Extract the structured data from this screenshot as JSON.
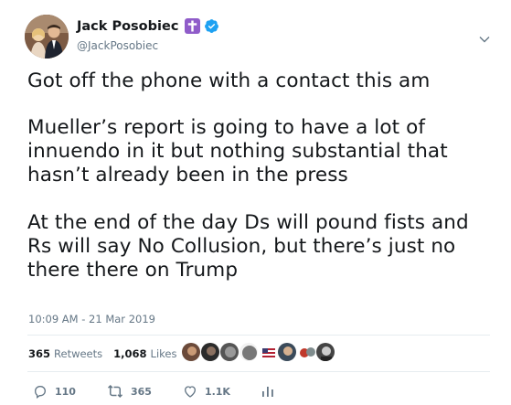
{
  "user": {
    "display_name": "Jack Posobiec",
    "handle": "@JackPosobiec",
    "verified": true,
    "name_emoji": "latin-cross-icon"
  },
  "tweet": {
    "paragraphs": [
      "Got off the phone with a contact this am",
      "Mueller’s report is going to have a lot of innuendo in it but nothing substantial that hasn’t already been in the press",
      "At the end of the day Ds will pound fists and Rs will say No Collusion, but there’s just no there there on Trump"
    ],
    "timestamp": "10:09 AM - 21 Mar 2019"
  },
  "stats": {
    "retweets_count": "365",
    "retweets_label": "Retweets",
    "likes_count": "1,068",
    "likes_label": "Likes"
  },
  "actions": {
    "reply_count": "110",
    "retweet_count": "365",
    "like_count": "1.1K"
  },
  "colors": {
    "text": "#14171a",
    "secondary": "#657786",
    "verified": "#1da1f2",
    "cross_badge": "#8f5cc9"
  }
}
